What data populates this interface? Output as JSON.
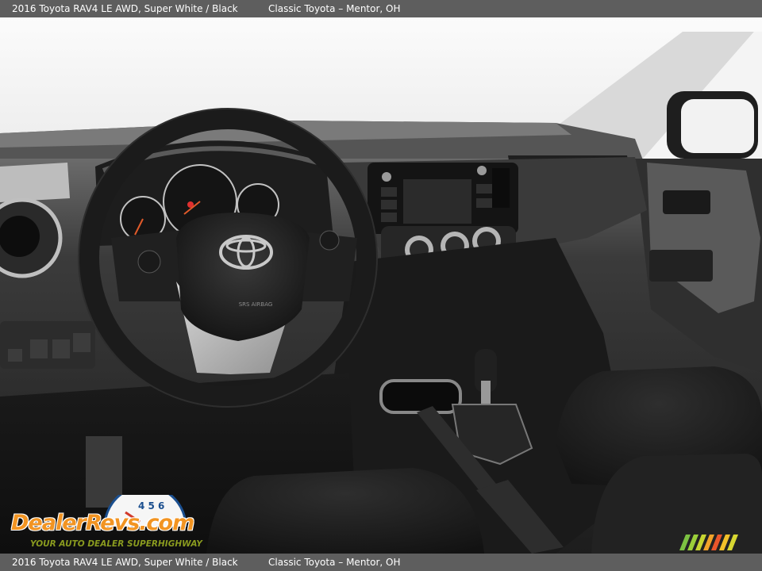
{
  "caption": {
    "vehicle": "2016 Toyota RAV4 LE AWD,  Super White / Black",
    "dealer": "Classic Toyota – Mentor, OH"
  },
  "watermark": {
    "wordmark": "DealerRevs.com",
    "tagline": "YOUR AUTO DEALER SUPERHIGHWAY"
  },
  "photo": {
    "steering_wheel_badge": "TOYOTA",
    "airbag_label": "SRS AIRBAG"
  },
  "colors": {
    "caption_bar": "#5e5e5e",
    "caption_text": "#ffffff",
    "logo_orange": "#f29422",
    "logo_green": "#8a9b1f",
    "logo_blue": "#1b4f8f"
  }
}
